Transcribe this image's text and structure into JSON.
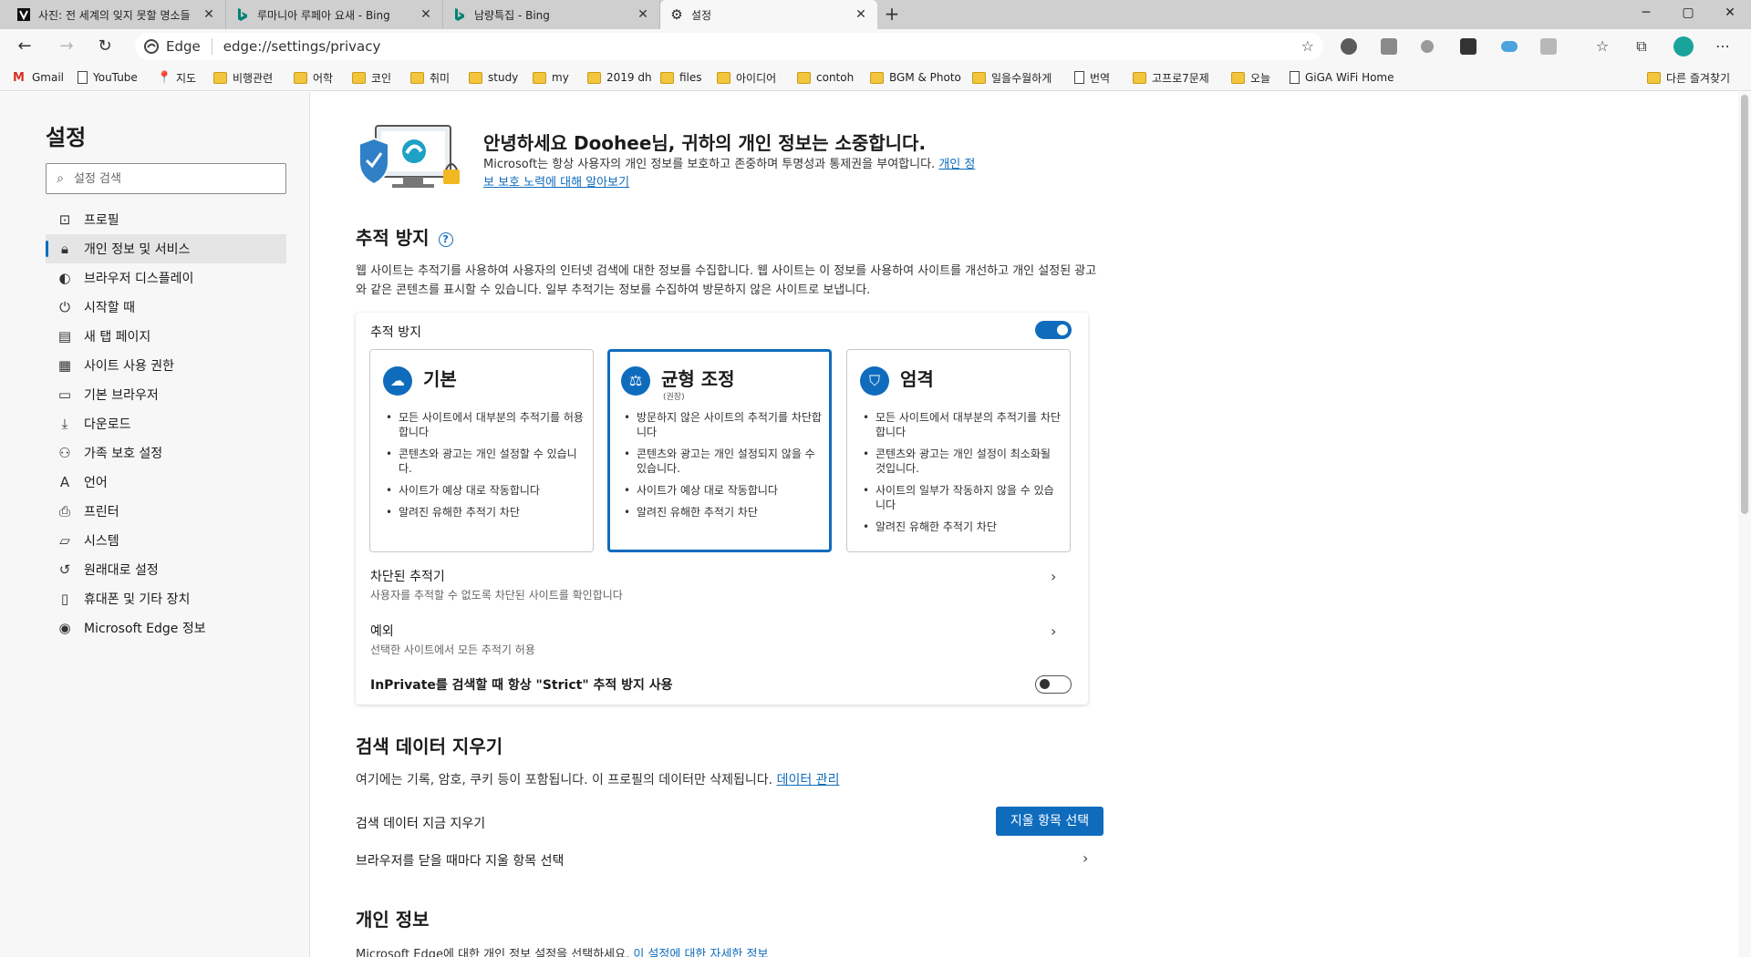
{
  "window": {
    "tabs": [
      {
        "label": "사진: 전 세계의 잊지 못할 명소들",
        "icon": "page-icon"
      },
      {
        "label": "루마니아 루페아 요새 - Bing",
        "icon": "bing-icon"
      },
      {
        "label": "남량특집 - Bing",
        "icon": "bing-icon"
      },
      {
        "label": "설정",
        "icon": "gear-icon"
      }
    ],
    "controls": {
      "minimize": "─",
      "maximize": "▢",
      "close": "✕"
    }
  },
  "toolbar": {
    "brand": "Edge",
    "url": "edge://settings/privacy"
  },
  "favorites": [
    {
      "label": "Gmail",
      "icon": "gmail-icon"
    },
    {
      "label": "YouTube",
      "icon": "page-icon"
    },
    {
      "label": "지도",
      "icon": "maps-icon"
    },
    {
      "label": "비행관련",
      "icon": "folder-icon"
    },
    {
      "label": "어학",
      "icon": "folder-icon"
    },
    {
      "label": "코인",
      "icon": "folder-icon"
    },
    {
      "label": "취미",
      "icon": "folder-icon"
    },
    {
      "label": "study",
      "icon": "folder-icon"
    },
    {
      "label": "my",
      "icon": "folder-icon"
    },
    {
      "label": "2019 dh",
      "icon": "folder-icon"
    },
    {
      "label": "files",
      "icon": "folder-icon"
    },
    {
      "label": "아이디어",
      "icon": "folder-icon"
    },
    {
      "label": "contoh",
      "icon": "folder-icon"
    },
    {
      "label": "BGM & Photo",
      "icon": "folder-icon"
    },
    {
      "label": "일을수월하게",
      "icon": "folder-icon"
    },
    {
      "label": "번역",
      "icon": "page-icon"
    },
    {
      "label": "고프로7문제",
      "icon": "folder-icon"
    },
    {
      "label": "오늘",
      "icon": "folder-icon"
    },
    {
      "label": "GiGA WiFi Home",
      "icon": "page-icon"
    },
    {
      "label": "다른 즐겨찾기",
      "icon": "folder-icon"
    }
  ],
  "sidebar": {
    "title": "설정",
    "search_placeholder": "설정 검색",
    "items": [
      {
        "label": "프로필",
        "icon": "profile-icon"
      },
      {
        "label": "개인 정보 및 서비스",
        "icon": "lock-icon"
      },
      {
        "label": "브라우저 디스플레이",
        "icon": "palette-icon"
      },
      {
        "label": "시작할 때",
        "icon": "power-icon"
      },
      {
        "label": "새 탭 페이지",
        "icon": "newtab-icon"
      },
      {
        "label": "사이트 사용 권한",
        "icon": "site-permissions-icon"
      },
      {
        "label": "기본 브라우저",
        "icon": "browser-icon"
      },
      {
        "label": "다운로드",
        "icon": "download-icon"
      },
      {
        "label": "가족 보호 설정",
        "icon": "family-icon"
      },
      {
        "label": "언어",
        "icon": "language-icon"
      },
      {
        "label": "프린터",
        "icon": "printer-icon"
      },
      {
        "label": "시스템",
        "icon": "system-icon"
      },
      {
        "label": "원래대로 설정",
        "icon": "reset-icon"
      },
      {
        "label": "휴대폰 및 기타 장치",
        "icon": "phone-icon"
      },
      {
        "label": "Microsoft Edge 정보",
        "icon": "edge-icon"
      }
    ]
  },
  "hero": {
    "title": "안녕하세요 Doohee님, 귀하의 개인 정보는 소중합니다.",
    "desc": "Microsoft는 항상 사용자의 개인 정보를 보호하고 존중하며 투명성과 통제권을 부여합니다.",
    "link": "개인 정보 보호 노력에 대해 알아보기"
  },
  "tracking": {
    "title": "추적 방지",
    "desc": "웹 사이트는 추적기를 사용하여 사용자의 인터넷 검색에 대한 정보를 수집합니다. 웹 사이트는 이 정보를 사용하여 사이트를 개선하고 개인 설정된 광고와 같은 콘텐츠를 표시할 수 있습니다. 일부 추적기는 정보를 수집하여 방문하지 않은 사이트로 보냅니다.",
    "toggle_label": "추적 방지",
    "enabled": true,
    "options": [
      {
        "title": "기본",
        "sub": "",
        "icon": "basic-icon",
        "selected": false,
        "bullets": [
          "모든 사이트에서 대부분의 추적기를 허용합니다",
          "콘텐츠와 광고는 개인 설정할 수 있습니다.",
          "사이트가 예상 대로 작동합니다",
          "알려진 유해한 추적기 차단"
        ]
      },
      {
        "title": "균형 조정",
        "sub": "(권장)",
        "icon": "balance-icon",
        "selected": true,
        "bullets": [
          "방문하지 않은 사이트의 추적기를 차단합니다",
          "콘텐츠와 광고는 개인 설정되지 않을 수 있습니다.",
          "사이트가 예상 대로 작동합니다",
          "알려진 유해한 추적기 차단"
        ]
      },
      {
        "title": "엄격",
        "sub": "",
        "icon": "strict-shield-icon",
        "selected": false,
        "bullets": [
          "모든 사이트에서 대부분의 추적기를 차단합니다",
          "콘텐츠와 광고는 개인 설정이 최소화될 것입니다.",
          "사이트의 일부가 작동하지 않을 수 있습니다",
          "알려진 유해한 추적기 차단"
        ]
      }
    ],
    "blocked_title": "차단된 추적기",
    "blocked_sub": "사용자를 추적할 수 없도록 차단된 사이트를 확인합니다",
    "exceptions_title": "예외",
    "exceptions_sub": "선택한 사이트에서 모든 추적기 허용",
    "strict_inprivate_label": "InPrivate를 검색할 때 항상 \"Strict\" 추적 방지 사용",
    "strict_inprivate_enabled": false
  },
  "clear_data": {
    "title": "검색 데이터 지우기",
    "desc": "여기에는 기록, 암호, 쿠키 등이 포함됩니다. 이 프로필의 데이터만 삭제됩니다.",
    "link": "데이터 관리",
    "now_label": "검색 데이터 지금 지우기",
    "button": "지울 항목 선택",
    "on_close_label": "브라우저를 닫을 때마다 지울 항목 선택"
  },
  "privacy": {
    "title": "개인 정보",
    "desc": "Microsoft Edge에 대한 개인 정보 설정을 선택하세요.",
    "link": "이 설정에 대한 자세한 정보"
  },
  "colors": {
    "accent": "#0f6cbd",
    "folder": "#f3c53c"
  }
}
